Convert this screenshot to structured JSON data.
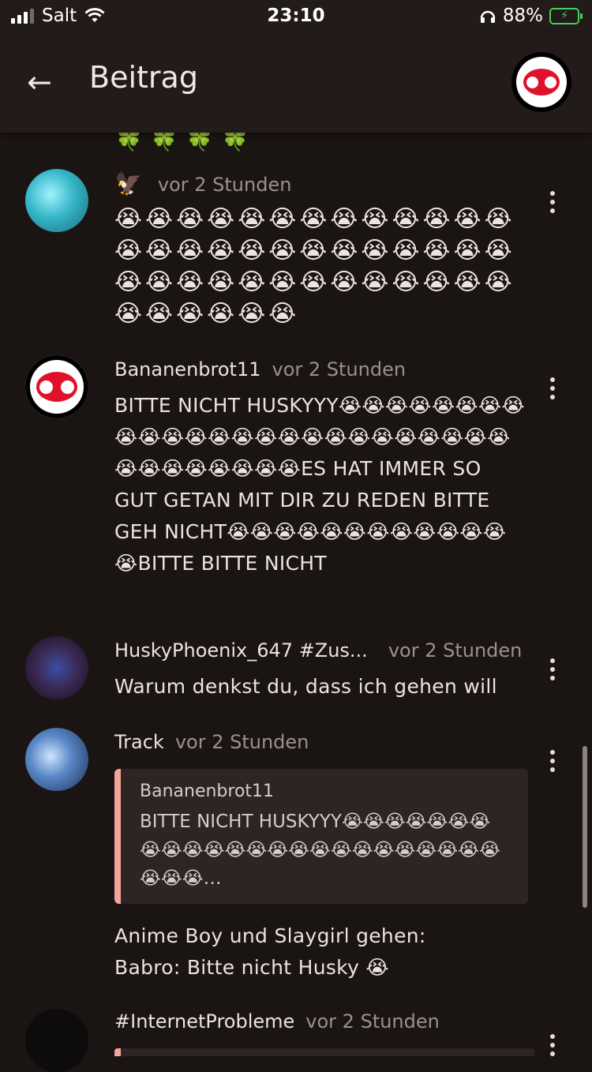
{
  "status_bar": {
    "carrier": "Salt",
    "time": "23:10",
    "battery_percent": "88%",
    "icons": [
      "signal-icon",
      "wifi-icon",
      "headphones-icon",
      "battery-charging-icon"
    ]
  },
  "app_bar": {
    "title": "Beitrag",
    "back_icon": "arrow-left-icon",
    "logo": "bananenbrot-logo"
  },
  "top_emoji_strip": "🍀🍀🍀🍀",
  "comments": [
    {
      "username": "🦅",
      "time": "vor 2 Stunden",
      "text": "😭😭😭😭😭😭😭😭😭😭😭😭😭😭😭😭😭😭😭😭😭😭😭😭😭😭😭😭😭😭😭😭😭😭😭😭😭😭😭😭😭😭😭😭😭"
    },
    {
      "username": "Bananenbrot11",
      "time": "vor 2 Stunden",
      "text": "BITTE NICHT HUSKYYY😭😭😭😭😭😭😭😭😭😭😭😭😭😭😭😭😭😭😭😭😭😭😭😭😭😭😭😭😭😭😭😭😭ES HAT IMMER SO GUT GETAN MIT DIR ZU REDEN BITTE GEH NICHT😭😭😭😭😭😭😭😭😭😭😭😭😭BITTE BITTE NICHT"
    },
    {
      "username": "HuskyPhoenix_647 #Zus...",
      "time": "vor 2 Stunden",
      "text": "Warum denkst du, dass ich gehen will"
    },
    {
      "username": "Track",
      "time": "vor 2 Stunden",
      "quote_user": "Bananenbrot11",
      "quote_text": "BITTE NICHT HUSKYYY😭😭😭😭😭😭😭😭😭😭😭😭😭😭😭😭😭😭😭😭😭😭😭😭😭😭😭…",
      "text_line1": "Anime Boy und Slaygirl gehen:",
      "text_line2": "Babro: Bitte nicht Husky 😭"
    },
    {
      "username": "#InternetProbleme",
      "time": "vor 2 Stunden"
    }
  ]
}
